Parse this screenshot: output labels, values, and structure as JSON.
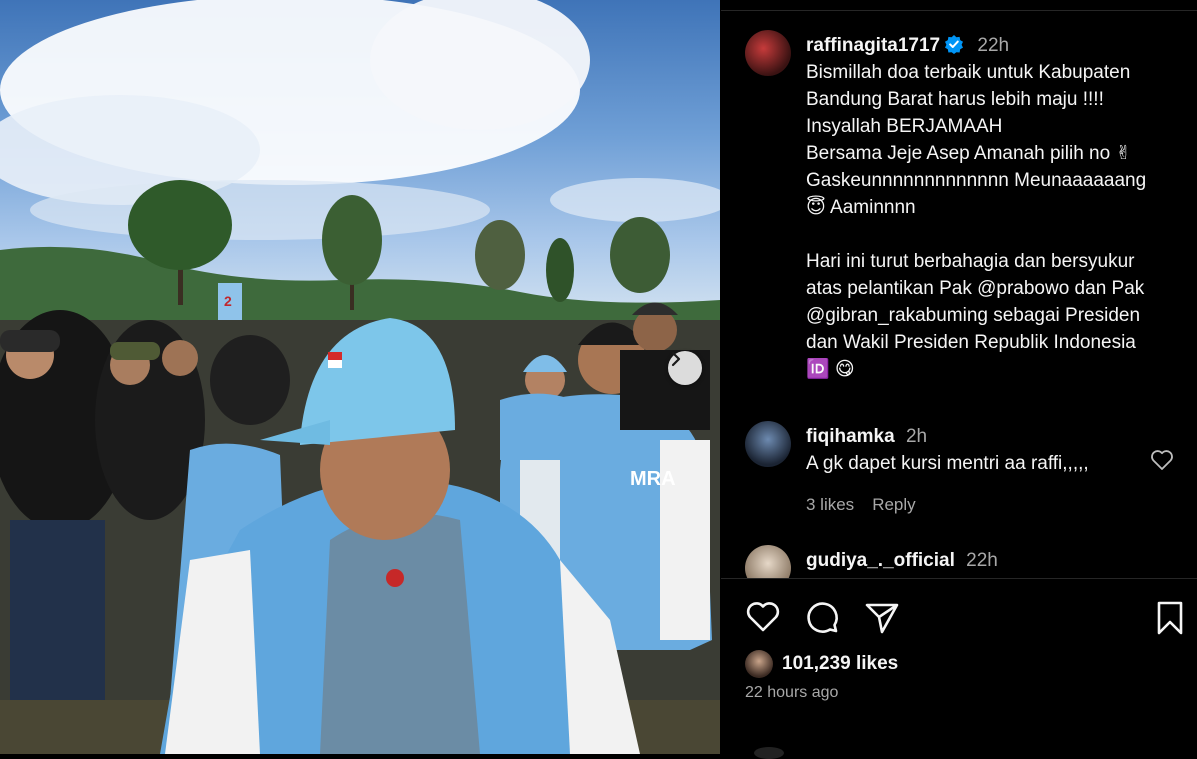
{
  "post": {
    "username": "raffinagita1717",
    "time": "22h",
    "caption_lines": [
      "Bismillah doa terbaik untuk Kabupaten",
      "Bandung Barat harus lebih maju !!!!",
      "Insyallah BERJAMAAH",
      "Bersama Jeje Asep Amanah pilih no ✌",
      "Gaskeunnnnnnnnnnnnn Meunaaaaaang",
      "😇 Aaminnnn",
      "",
      "Hari ini turut berbahagia dan bersyukur",
      "atas pelantikan Pak @prabowo dan Pak",
      "@gibran_rakabuming sebagai Presiden",
      "dan Wakil Presiden Republik Indonesia",
      "🆔 😋"
    ]
  },
  "comments": [
    {
      "username": "fiqihamka",
      "time": "2h",
      "text": "A gk dapet kursi mentri aa raffi,,,,,",
      "likes": "3 likes",
      "reply": "Reply"
    },
    {
      "username": "gudiya_._official",
      "time": "22h"
    }
  ],
  "actions": {
    "like_icon": "heart-icon",
    "comment_icon": "comment-bubble-icon",
    "share_icon": "paper-plane-icon",
    "save_icon": "bookmark-icon"
  },
  "likes_count": "101,239 likes",
  "posted_ago": "22 hours ago",
  "media": {
    "next_icon": "chevron-right-icon",
    "jersey_text": "MRA",
    "banner_text": "2"
  },
  "colors": {
    "verified": "#0095f6",
    "secondary_text": "#a8a8a8",
    "background": "#000000"
  }
}
